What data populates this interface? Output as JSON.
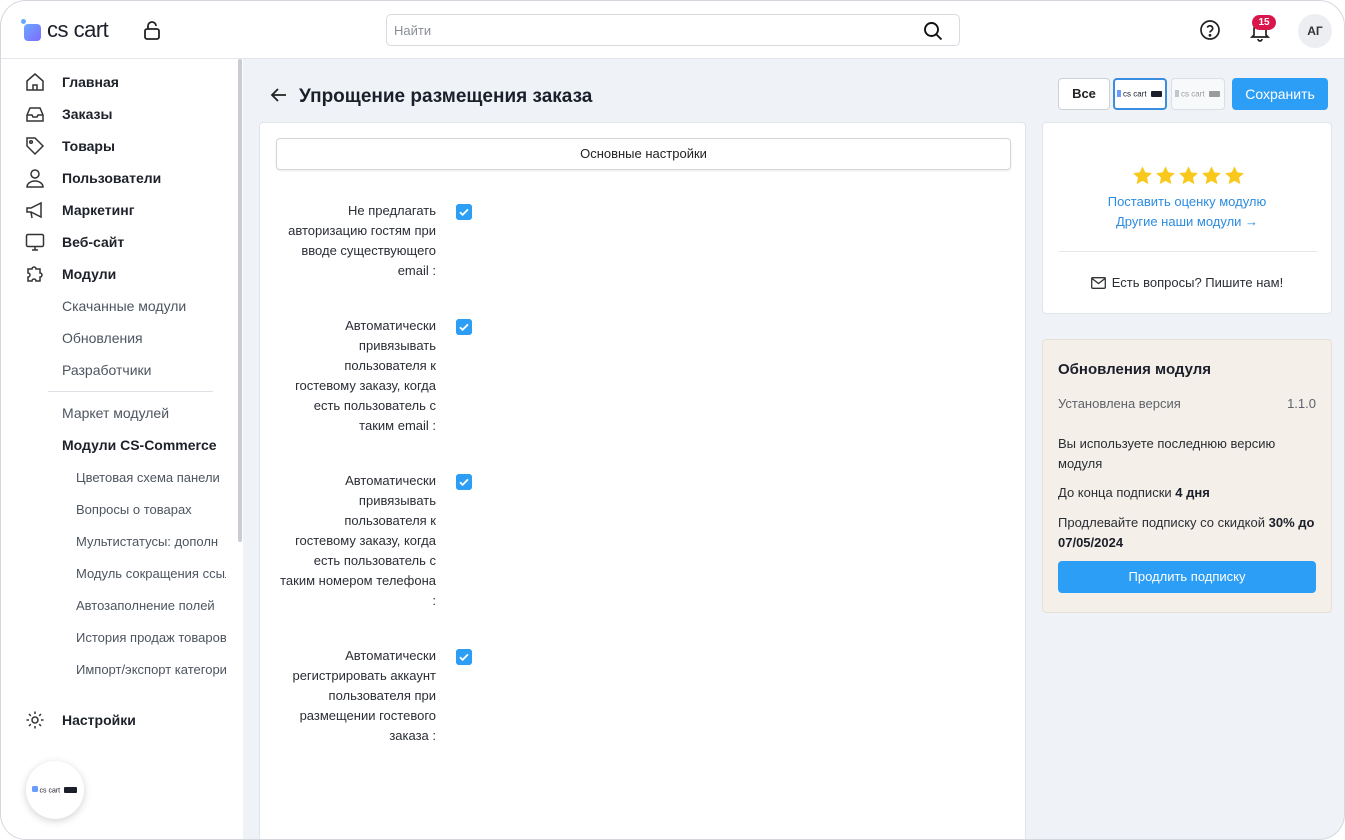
{
  "header": {
    "logo_text": "cs cart",
    "search_placeholder": "Найти",
    "notification_count": "15",
    "avatar_initials": "АГ"
  },
  "sidebar": {
    "items": [
      {
        "label": "Главная",
        "icon": "home-icon"
      },
      {
        "label": "Заказы",
        "icon": "inbox-icon"
      },
      {
        "label": "Товары",
        "icon": "tag-icon"
      },
      {
        "label": "Пользователи",
        "icon": "user-icon"
      },
      {
        "label": "Маркетинг",
        "icon": "megaphone-icon"
      },
      {
        "label": "Веб-сайт",
        "icon": "monitor-icon"
      },
      {
        "label": "Модули",
        "icon": "puzzle-icon"
      }
    ],
    "modules_sub": [
      "Скачанные модули",
      "Обновления",
      "Разработчики"
    ],
    "market_sub": [
      "Маркет модулей",
      "Модули CS-Commerce"
    ],
    "cs_commerce_sub": [
      "Цветовая схема панели",
      "Вопросы о товарах",
      "Мультистатусы: дополн",
      "Модуль сокращения ссылок",
      "Автозаполнение полей",
      "История продаж товаров",
      "Импорт/экспорт категорий"
    ],
    "settings_label": "Настройки"
  },
  "page": {
    "title": "Упрощение размещения заказа",
    "all_button": "Все",
    "storefront_label": "cs cart",
    "save_button": "Сохранить",
    "tab_label": "Основные настройки",
    "settings": [
      {
        "label": "Не предлагать авторизацию гостям при вводе существующего email :",
        "checked": true
      },
      {
        "label": "Автоматически привязывать пользователя к гостевому заказу, когда есть пользователь с таким email :",
        "checked": true
      },
      {
        "label": "Автоматически привязывать пользователя к гостевому заказу, когда есть пользователь с таким номером телефона :",
        "checked": true
      },
      {
        "label": "Автоматически регистрировать аккаунт пользователя при размещении гостевого заказа :",
        "checked": true
      }
    ]
  },
  "rating": {
    "stars": 5,
    "rate_link": "Поставить оценку модулю",
    "other_link": "Другие наши модули →",
    "contact_text": "Есть вопросы? Пишите нам!"
  },
  "updates": {
    "title": "Обновления модуля",
    "version_label": "Установлена версия",
    "version_value": "1.1.0",
    "latest_text": "Вы используете последнюю версию модуля",
    "sub_prefix": "До конца подписки",
    "sub_days": "4 дня",
    "discount_prefix": "Продлевайте подписку со скидкой",
    "discount_value": "30% до 07/05/2024",
    "extend_button": "Продлить подписку"
  },
  "colors": {
    "accent": "#2c9ef6",
    "badge": "#d9164b",
    "link": "#2c8ce0",
    "star": "#f8c91c",
    "updates_bg": "#f4efe8"
  }
}
